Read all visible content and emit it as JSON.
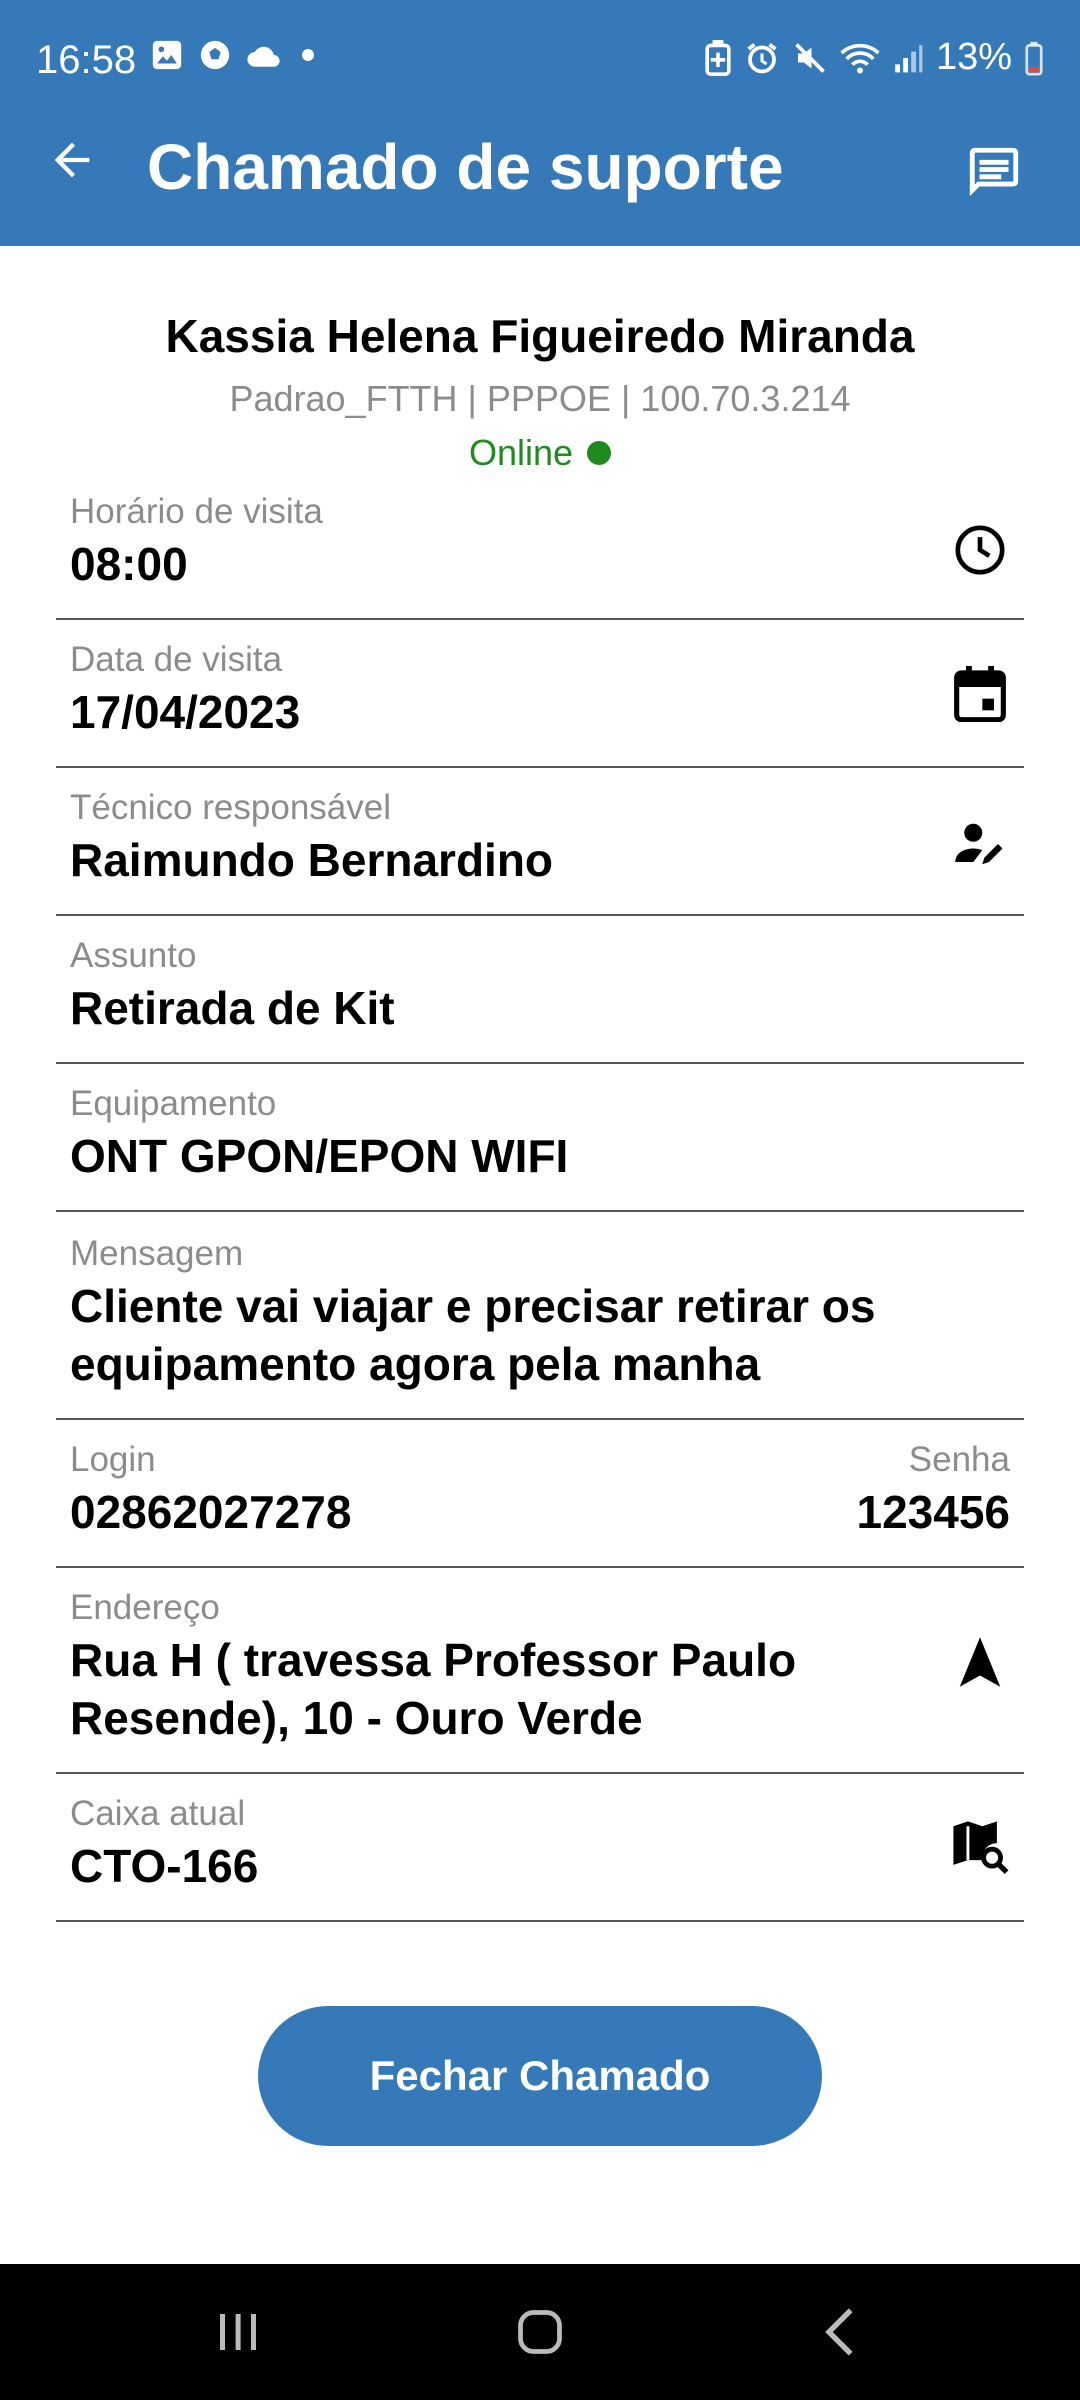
{
  "status_bar": {
    "time": "16:58",
    "battery": "13%",
    "left_icons": [
      "image-icon",
      "soccer-ball-icon",
      "cloud-icon",
      "dot-icon"
    ],
    "right_icons": [
      "battery-saver-icon",
      "alarm-icon",
      "mute-icon",
      "wifi-icon",
      "signal-icon",
      "battery-icon"
    ]
  },
  "header": {
    "title": "Chamado de suporte",
    "back_icon": "arrow-back-icon",
    "chat_icon": "message-icon"
  },
  "client": {
    "name": "Kassia Helena Figueiredo Miranda",
    "plan_info": "Padrao_FTTH | PPPOE | 100.70.3.214",
    "status": "Online",
    "status_color": "#1f8a1f"
  },
  "fields": {
    "horario": {
      "label": "Horário de visita",
      "value": "08:00",
      "icon": "clock-icon"
    },
    "data": {
      "label": "Data de visita",
      "value": "17/04/2023",
      "icon": "calendar-icon"
    },
    "tecnico": {
      "label": "Técnico responsável",
      "value": "Raimundo Bernardino",
      "icon": "person-edit-icon"
    },
    "assunto": {
      "label": "Assunto",
      "value": "Retirada de Kit"
    },
    "equipamento": {
      "label": "Equipamento",
      "value": "ONT GPON/EPON WIFI"
    },
    "mensagem": {
      "label": "Mensagem",
      "value_line1": "Cliente vai viajar e precisar retirar os",
      "value_line2": "equipamento agora pela manha"
    },
    "login": {
      "label": "Login",
      "value": "02862027278"
    },
    "senha": {
      "label": "Senha",
      "value": "123456"
    },
    "endereco": {
      "label": "Endereço",
      "value_line1": "Rua H ( travessa Professor Paulo",
      "value_line2": "Resende), 10 - Ouro Verde",
      "icon": "navigation-icon"
    },
    "caixa": {
      "label": "Caixa atual",
      "value": "CTO-166",
      "icon": "map-search-icon"
    }
  },
  "actions": {
    "close_label": "Fechar Chamado"
  },
  "colors": {
    "primary": "#3579b8",
    "online": "#1f8a1f"
  }
}
